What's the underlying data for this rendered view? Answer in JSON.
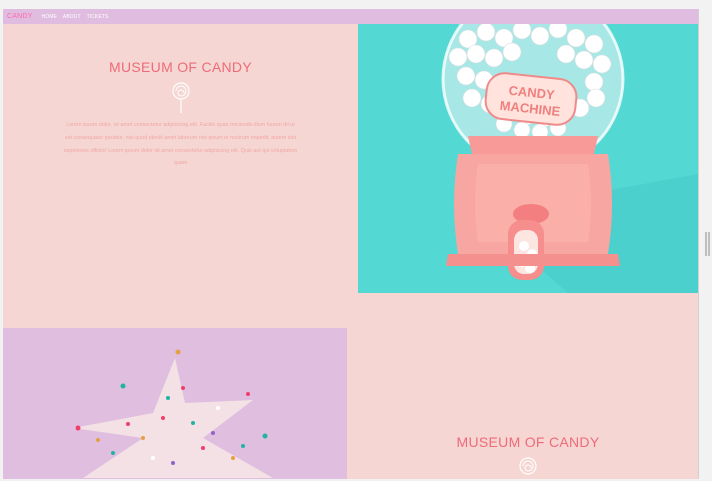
{
  "navbar": {
    "brand": "CANDY",
    "links": [
      "HOME",
      "ABOUT",
      "TICKETS"
    ]
  },
  "hero": {
    "title": "MUSEUM OF CANDY",
    "body": "Lorem ipsum dolor, sit amet consectetur adipisicing elit. Facilis quas reiciendis illum harum ibi ut est consequatur pariatur, nisi quod eleniti amet laborum nisi ipsum in nostrum impedit, autem sint asperiores officiis! Lorem ipsum dolor sit amet consectetur adipisicing elit. Quis aut qui voluptatem quam"
  },
  "machine_image": {
    "label_line1": "CANDY",
    "label_line2": "MACHINE"
  },
  "lower_section": {
    "title": "MUSEUM OF CANDY"
  },
  "colors": {
    "page_bg": "#f5d6d2",
    "navbar_bg": "#e0bde0",
    "brand": "#ff6aa8",
    "title": "#ee6b7a",
    "body_text": "#f1a7a7",
    "teal": "#53d8d4",
    "lilac": "#dfbedf"
  },
  "icons": [
    "lollipop-icon",
    "scrollbar-handle-icon"
  ]
}
